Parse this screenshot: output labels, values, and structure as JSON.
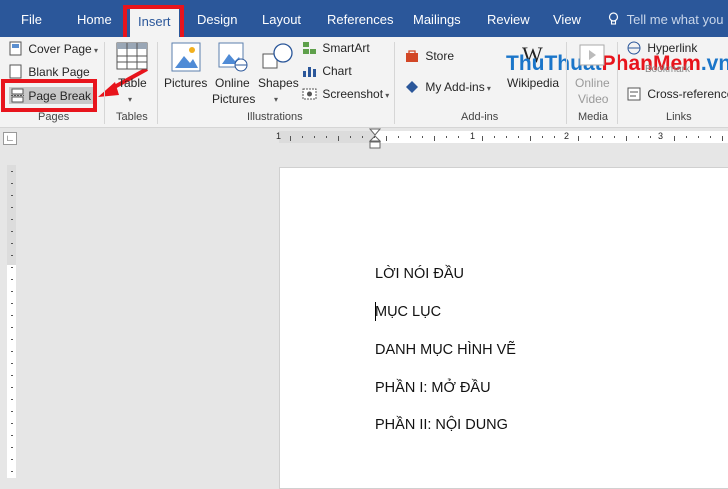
{
  "tabs": [
    "File",
    "Home",
    "Insert",
    "Design",
    "Layout",
    "References",
    "Mailings",
    "Review",
    "View"
  ],
  "tell_me": "Tell me what you",
  "pages_group": {
    "cover_page": "Cover Page",
    "blank_page": "Blank Page",
    "page_break": "Page Break",
    "label": "Pages"
  },
  "tables_group": {
    "table": "Table",
    "label": "Tables"
  },
  "illustrations_group": {
    "pictures": "Pictures",
    "online_pictures_1": "Online",
    "online_pictures_2": "Pictures",
    "shapes": "Shapes",
    "smartart": "SmartArt",
    "chart": "Chart",
    "screenshot": "Screenshot",
    "label": "Illustrations"
  },
  "addins_group": {
    "store": "Store",
    "my_addins": "My Add-ins",
    "wikipedia": "Wikipedia",
    "label": "Add-ins"
  },
  "media_group": {
    "online_video_1": "Online",
    "online_video_2": "Video",
    "label": "Media"
  },
  "links_group": {
    "hyperlink": "Hyperlink",
    "bookmark": "Bookmark",
    "cross_reference": "Cross-reference",
    "label": "Links"
  },
  "watermark": {
    "part1": "ThuThuat",
    "part2": "PhanMem",
    "part3": ".vn"
  },
  "ruler_numbers": [
    "1",
    "1",
    "2",
    "3"
  ],
  "document": {
    "paragraphs": [
      "LỜI NÓI ĐẦU",
      "MỤC LỤC",
      "DANH MỤC HÌNH VẼ",
      "PHẦN I: MỞ ĐẦU",
      "PHẦN II: NỘI DUNG"
    ]
  },
  "colors": {
    "accent": "#2b579a",
    "highlight": "#e8141c"
  }
}
